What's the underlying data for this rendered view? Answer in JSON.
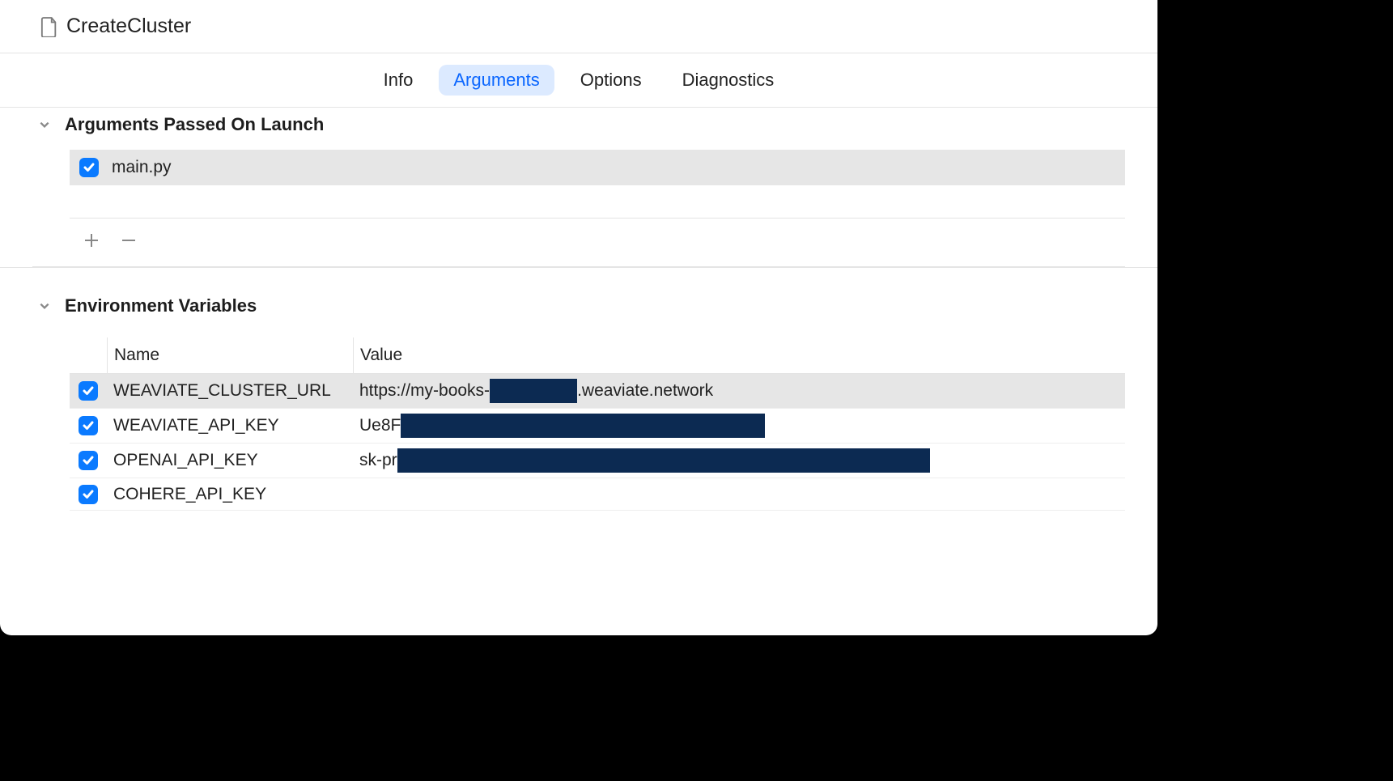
{
  "header": {
    "title": "CreateCluster"
  },
  "tabs": {
    "info": "Info",
    "arguments": "Arguments",
    "options": "Options",
    "diagnostics": "Diagnostics",
    "active": "arguments"
  },
  "sections": {
    "arguments_title": "Arguments Passed On Launch",
    "env_title": "Environment Variables"
  },
  "arguments": [
    {
      "checked": true,
      "value": "main.py"
    }
  ],
  "env_headers": {
    "name": "Name",
    "value": "Value"
  },
  "env": [
    {
      "checked": true,
      "name": "WEAVIATE_CLUSTER_URL",
      "value_prefix": "https://my-books-",
      "value_suffix": ".weaviate.network",
      "redact_width": 108,
      "selected": true
    },
    {
      "checked": true,
      "name": "WEAVIATE_API_KEY",
      "value_prefix": "Ue8F",
      "value_suffix": "",
      "redact_width": 450,
      "selected": false
    },
    {
      "checked": true,
      "name": "OPENAI_API_KEY",
      "value_prefix": "sk-pr",
      "value_suffix": "",
      "redact_width": 658,
      "selected": false
    },
    {
      "checked": true,
      "name": "COHERE_API_KEY",
      "value_prefix": "",
      "value_suffix": "",
      "redact_width": 0,
      "selected": false
    }
  ]
}
